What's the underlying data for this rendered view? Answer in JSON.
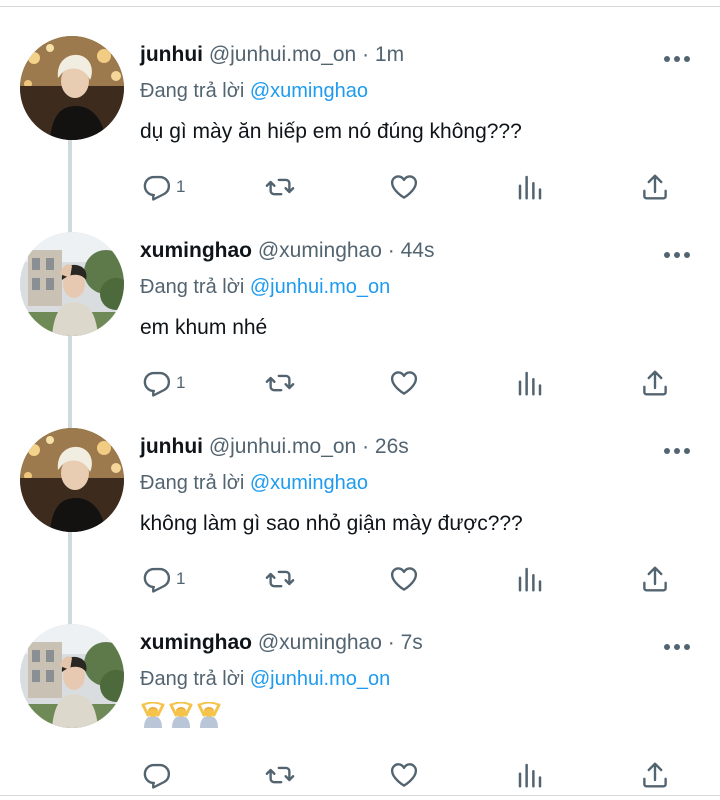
{
  "colors": {
    "link": "#1d9bf0",
    "muted": "#536471",
    "text": "#0f1419",
    "divider": "#d6d9db",
    "thread_line": "#cfd9de"
  },
  "tweets": [
    {
      "name": "junhui",
      "handle": "@junhui.mo_on",
      "time": "1m",
      "reply_prefix": "Đang trả lời",
      "reply_to": "@xuminghao",
      "text": "dụ gì mày ăn hiếp em nó đúng không???",
      "reply_count": "1",
      "avatar": "avatar-junhui"
    },
    {
      "name": "xuminghao",
      "handle": "@xuminghao",
      "time": "44s",
      "reply_prefix": "Đang trả lời",
      "reply_to": "@junhui.mo_on",
      "text": "em khum nhé",
      "reply_count": "1",
      "avatar": "avatar-xuminghao"
    },
    {
      "name": "junhui",
      "handle": "@junhui.mo_on",
      "time": "26s",
      "reply_prefix": "Đang trả lời",
      "reply_to": "@xuminghao",
      "text": "không làm gì sao nhỏ giận mày được???",
      "reply_count": "1",
      "avatar": "avatar-junhui"
    },
    {
      "name": "xuminghao",
      "handle": "@xuminghao",
      "time": "7s",
      "reply_prefix": "Đang trả lời",
      "reply_to": "@junhui.mo_on",
      "emoji": [
        "person-gesturing-ok-emoji",
        "person-gesturing-ok-emoji",
        "person-gesturing-ok-emoji"
      ],
      "avatar": "avatar-xuminghao"
    }
  ],
  "icons": {
    "reply": "reply-icon",
    "retweet": "retweet-icon",
    "like": "like-icon",
    "views": "views-icon",
    "share": "share-icon",
    "more": "more-icon"
  }
}
